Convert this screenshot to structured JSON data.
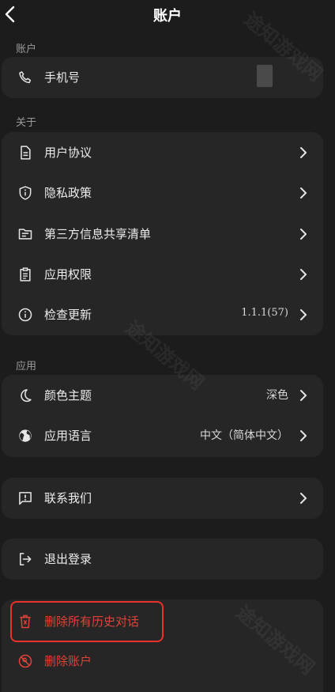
{
  "header": {
    "title": "账户"
  },
  "sections": {
    "account": "账户",
    "about": "关于",
    "app": "应用"
  },
  "account": {
    "phone_label": "手机号"
  },
  "about": {
    "user_agreement": "用户协议",
    "privacy_policy": "隐私政策",
    "third_party_list": "第三方信息共享清单",
    "app_permissions": "应用权限",
    "check_update": "检查更新",
    "version": "1.1.1(57)"
  },
  "app": {
    "color_theme": "颜色主题",
    "color_theme_value": "深色",
    "app_language": "应用语言",
    "app_language_value": "中文（简体中文）"
  },
  "contact": {
    "label": "联系我们"
  },
  "logout": {
    "label": "退出登录"
  },
  "danger": {
    "delete_history": "删除所有历史对话",
    "delete_account": "删除账户"
  },
  "watermark": "途知游戏网",
  "colors": {
    "danger": "#e0423a",
    "highlight": "#e8322a",
    "background": "#1c1c1c",
    "card": "#262626"
  }
}
